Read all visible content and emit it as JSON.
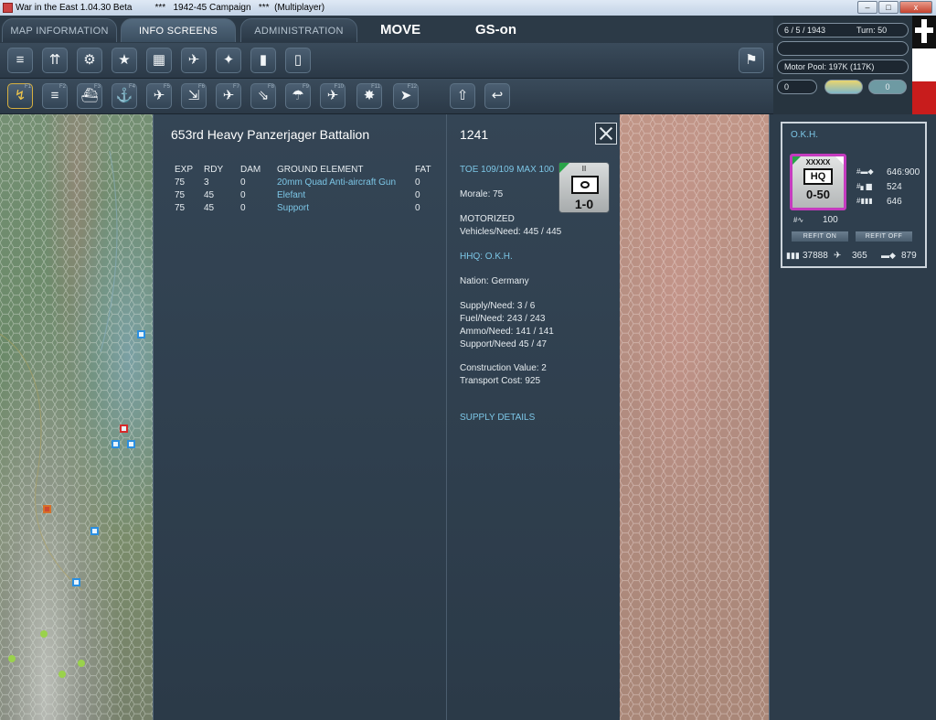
{
  "window": {
    "title": "War in the East 1.04.30 Beta         ***   1942-45 Campaign   ***  (Multiplayer)",
    "minimize": "–",
    "maximize": "□",
    "close": "x"
  },
  "tabs": [
    {
      "label": "MAP INFORMATION"
    },
    {
      "label": "INFO SCREENS"
    },
    {
      "label": "ADMINISTRATION"
    }
  ],
  "mode_labels": {
    "move": "MOVE",
    "gs": "GS-on"
  },
  "toolbar1": {
    "icons": [
      "hamburger-units-icon",
      "infantry-icon",
      "gear-icon",
      "star-icon",
      "grid-map-icon",
      "air-combat-icon",
      "bomb-strike-icon",
      "battery-icon",
      "tablet-icon",
      "surrender-flag-icon"
    ]
  },
  "toolbar2": {
    "keys": [
      "F1",
      "F2",
      "F3",
      "F4",
      "F5",
      "F6",
      "F7",
      "F8",
      "F9",
      "F10",
      "F11",
      "F12"
    ]
  },
  "status": {
    "date": "6 / 5 / 1943",
    "turn": "Turn: 50",
    "motor_pool": "Motor Pool: 197K (117K)",
    "counter_value": "0",
    "toggle_value": "0"
  },
  "unit": {
    "name": "653rd Heavy Panzerjager Battalion",
    "id": "1241",
    "columns": [
      "EXP",
      "RDY",
      "DAM",
      "GROUND ELEMENT",
      "FAT"
    ],
    "elements": [
      {
        "exp": "75",
        "rdy": "3",
        "dam": "0",
        "element": "20mm Quad Anti-aircraft Gun",
        "fat": "0"
      },
      {
        "exp": "75",
        "rdy": "45",
        "dam": "0",
        "element": "Elefant",
        "fat": "0"
      },
      {
        "exp": "75",
        "rdy": "45",
        "dam": "0",
        "element": "Support",
        "fat": "0"
      }
    ],
    "toe": "TOE 109/109 MAX 100",
    "morale": "Morale:   75",
    "motorized": "MOTORIZED",
    "vehicles": "Vehicles/Need:   445 / 445",
    "hhq": "HHQ: O.K.H.",
    "nation": "Nation:   Germany",
    "supply": "Supply/Need:    3 / 6",
    "fuel": "Fuel/Need:        243 / 243",
    "ammo": "Ammo/Need:     141 / 141",
    "support": "Support/Need     45 / 47",
    "construction": "Construction Value:  2",
    "transport": "Transport Cost:      925",
    "supply_details": "SUPPLY DETAILS",
    "counter": {
      "echelon": "II",
      "strength": "1-0"
    }
  },
  "hq": {
    "name": "O.K.H.",
    "echelon": "XXXXX",
    "type": "HQ",
    "strength": "0-50",
    "tanks": "646:900",
    "guns": "524",
    "men": "646",
    "value": "100",
    "refit_on": "REFIT ON",
    "refit_off": "REFIT OFF",
    "footer_men": "37888",
    "footer_air": "365",
    "footer_tanks": "879"
  }
}
